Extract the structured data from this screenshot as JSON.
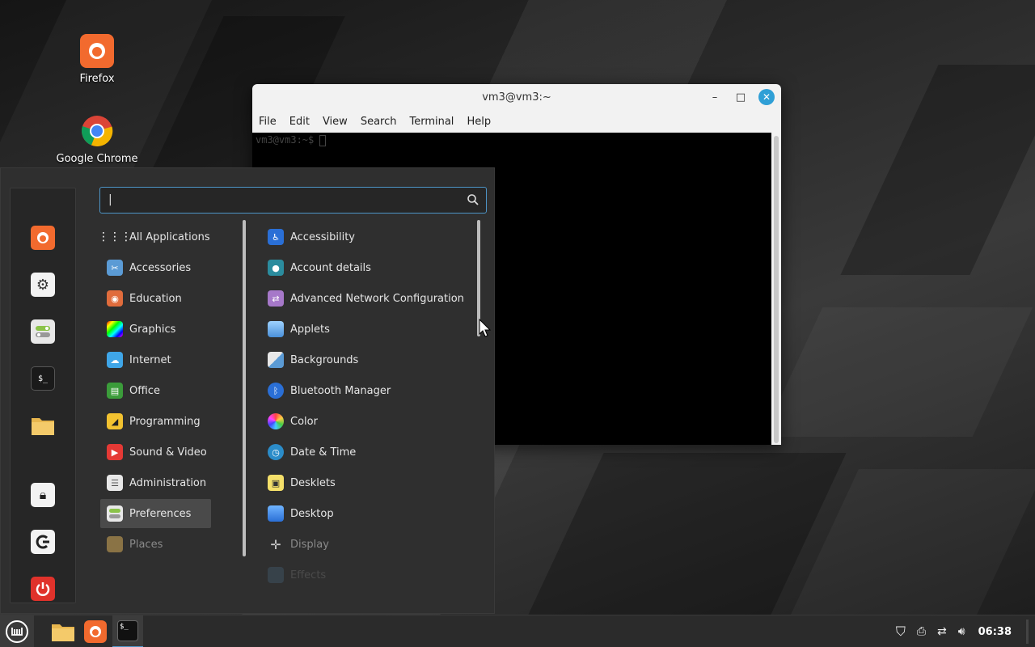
{
  "desktop": {
    "icons": [
      {
        "label": "Firefox"
      },
      {
        "label": "Google Chrome"
      }
    ]
  },
  "terminal": {
    "title": "vm3@vm3:~",
    "menu": [
      "File",
      "Edit",
      "View",
      "Search",
      "Terminal",
      "Help"
    ],
    "prompt": "vm3@vm3:~$ ",
    "controls": {
      "minimize": "–",
      "maximize": "□",
      "close": "✕"
    }
  },
  "menu": {
    "search": {
      "value": "|",
      "placeholder": ""
    },
    "categories": [
      {
        "label": "All Applications"
      },
      {
        "label": "Accessories"
      },
      {
        "label": "Education"
      },
      {
        "label": "Graphics"
      },
      {
        "label": "Internet"
      },
      {
        "label": "Office"
      },
      {
        "label": "Programming"
      },
      {
        "label": "Sound & Video"
      },
      {
        "label": "Administration"
      },
      {
        "label": "Preferences"
      },
      {
        "label": "Places"
      }
    ],
    "apps": [
      {
        "label": "Accessibility"
      },
      {
        "label": "Account details"
      },
      {
        "label": "Advanced Network Configuration"
      },
      {
        "label": "Applets"
      },
      {
        "label": "Backgrounds"
      },
      {
        "label": "Bluetooth Manager"
      },
      {
        "label": "Color"
      },
      {
        "label": "Date & Time"
      },
      {
        "label": "Desklets"
      },
      {
        "label": "Desktop"
      },
      {
        "label": "Display"
      },
      {
        "label": "Effects"
      }
    ]
  },
  "panel": {
    "clock": "06:38"
  },
  "colors": {
    "accent": "#4d95c7",
    "firefox": "#f26a2e",
    "power": "#e0322b"
  }
}
